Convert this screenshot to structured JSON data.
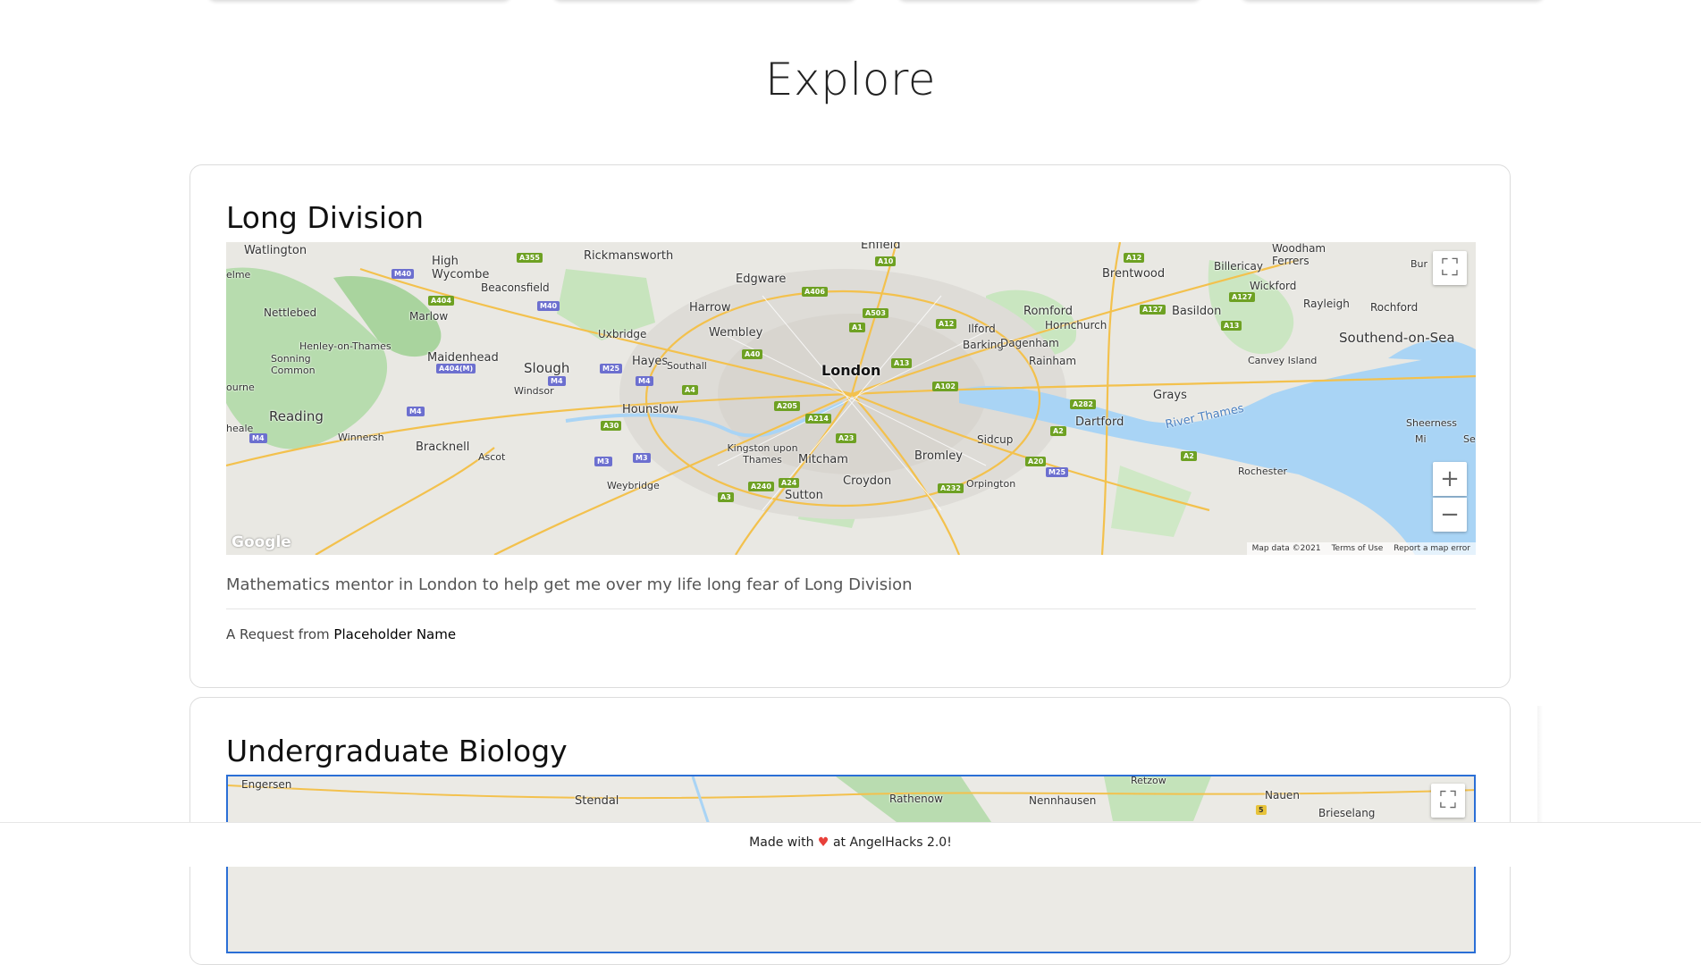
{
  "page": {
    "title": "Explore"
  },
  "requests": [
    {
      "title": "Long Division",
      "description": "Mathematics mentor in London to help get me over my life long fear of Long Division",
      "request_prefix": "A Request from",
      "requester": "Placeholder Name",
      "map": {
        "places": [
          "Watlington",
          "High Wycombe",
          "Rickmansworth",
          "Enfield",
          "Woodham Ferrers",
          "Billericay",
          "Brentwood",
          "Wickford",
          "Edgware",
          "Beaconsfield",
          "Nettlebed",
          "Marlow",
          "Harrow",
          "Romford",
          "Basildon",
          "Rayleigh",
          "Rochford",
          "Hornchurch",
          "Uxbridge",
          "Wembley",
          "Ilford",
          "Barking",
          "Dagenham",
          "Southend-on-Sea",
          "Henley-on-Thames",
          "Sonning Common",
          "Maidenhead",
          "Slough",
          "Hayes",
          "Southall",
          "London",
          "Rainham",
          "Canvey Island",
          "Windsor",
          "Grays",
          "Hounslow",
          "Reading",
          "Dartford",
          "River Thames",
          "Winnersh",
          "Bracknell",
          "Sidcup",
          "Kingston upon Thames",
          "Ascot",
          "Mitcham",
          "Bromley",
          "Rochester",
          "Croydon",
          "Orpington",
          "Weybridge",
          "Sutton",
          "Sheerness",
          "Bur",
          "elme",
          "ourne",
          "heale",
          "Mi",
          "Se"
        ],
        "roads": [
          "M40",
          "A355",
          "A10",
          "A12",
          "A404",
          "M40",
          "A406",
          "A503",
          "A127",
          "A127",
          "A1",
          "A12",
          "A13",
          "M25",
          "A40",
          "A404(M)",
          "M4",
          "M4",
          "A13",
          "A102",
          "A4",
          "A205",
          "A282",
          "A214",
          "A30",
          "A2",
          "M4",
          "A23",
          "M3",
          "M3",
          "A20",
          "M25",
          "A2",
          "M4",
          "A240",
          "A24",
          "A232",
          "A3"
        ],
        "footer": {
          "map_data": "Map data ©2021",
          "terms": "Terms of Use",
          "report": "Report a map error"
        },
        "logo": "Google"
      }
    },
    {
      "title": "Undergraduate Biology",
      "map": {
        "places": [
          "Engersen",
          "Stendal",
          "Rathenow",
          "Nennhausen",
          "Retzow",
          "Nauen",
          "Brieselang"
        ],
        "roads": [
          "5"
        ]
      }
    }
  ],
  "footer": {
    "prefix": "Made with",
    "heart": "♥",
    "suffix": "at AngelHacks 2.0!"
  },
  "controls": {
    "fullscreen": "⛶",
    "zoom_in": "+",
    "zoom_out": "−"
  }
}
